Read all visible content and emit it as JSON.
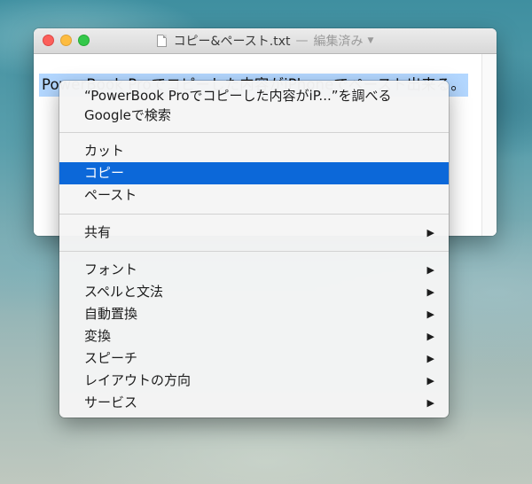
{
  "window": {
    "title": "コピー&ペースト.txt",
    "title_separator": "—",
    "status": "編集済み",
    "selected_text": "PowerBook Proでコピーした内容がiPhoneでペースト出来る。"
  },
  "context_menu": {
    "lookup_line1": "“PowerBook Proでコピーした内容がiP...”を調べる",
    "lookup_line2": "Googleで検索",
    "items": [
      {
        "label": "カット"
      },
      {
        "label": "コピー"
      },
      {
        "label": "ペースト"
      }
    ],
    "share": "共有",
    "submenus": [
      {
        "label": "フォント"
      },
      {
        "label": "スペルと文法"
      },
      {
        "label": "自動置換"
      },
      {
        "label": "変換"
      },
      {
        "label": "スピーチ"
      },
      {
        "label": "レイアウトの方向"
      },
      {
        "label": "サービス"
      }
    ],
    "arrow_glyph": "▶",
    "highlight_color": "#0c68d9"
  }
}
